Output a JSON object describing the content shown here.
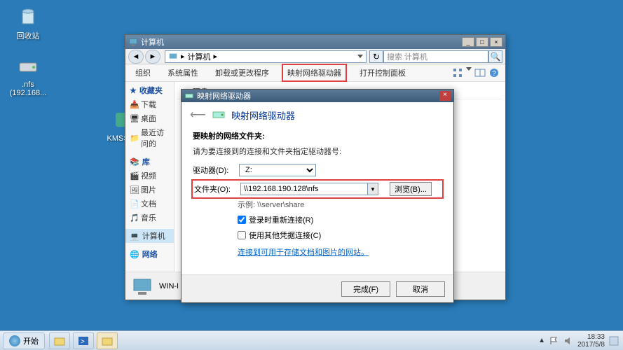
{
  "desktop": {
    "recycle_bin": "回收站",
    "nfs_share": ".nfs\n(192.168...",
    "kms": "KMSSv..."
  },
  "explorer": {
    "title": "计算机",
    "address": "计算机",
    "search_placeholder": "搜索 计算机",
    "toolbar": {
      "organize": "组织",
      "properties": "系统属性",
      "uninstall": "卸载或更改程序",
      "map_drive": "映射网络驱动器",
      "control_panel": "打开控制面板"
    },
    "sidebar": {
      "favorites": "收藏夹",
      "fav_items": [
        "下载",
        "桌面",
        "最近访问的"
      ],
      "library": "库",
      "lib_items": [
        "视频",
        "图片",
        "文档",
        "音乐"
      ],
      "computer": "计算机",
      "network": "网络"
    },
    "content": {
      "hdd_header": "硬盘 (1)"
    },
    "footer_label": "WIN-I"
  },
  "dialog": {
    "title": "映射网络驱动器",
    "header": "映射网络驱动器",
    "section_title": "要映射的网络文件夹:",
    "instruction": "请为要连接到的连接和文件夹指定驱动器号:",
    "drive_label": "驱动器(D):",
    "drive_value": "Z:",
    "folder_label": "文件夹(O):",
    "folder_value": "\\\\192.168.190.128\\nfs",
    "browse_label": "浏览(B)...",
    "example": "示例: \\\\server\\share",
    "reconnect_label": "登录时重新连接(R)",
    "reconnect_checked": true,
    "other_creds_label": "使用其他凭据连接(C)",
    "other_creds_checked": false,
    "link_text": "连接到可用于存储文档和图片的网站。",
    "finish_btn": "完成(F)",
    "cancel_btn": "取消"
  },
  "taskbar": {
    "start_label": "开始",
    "time": "18:33",
    "date": "2017/5/8"
  }
}
